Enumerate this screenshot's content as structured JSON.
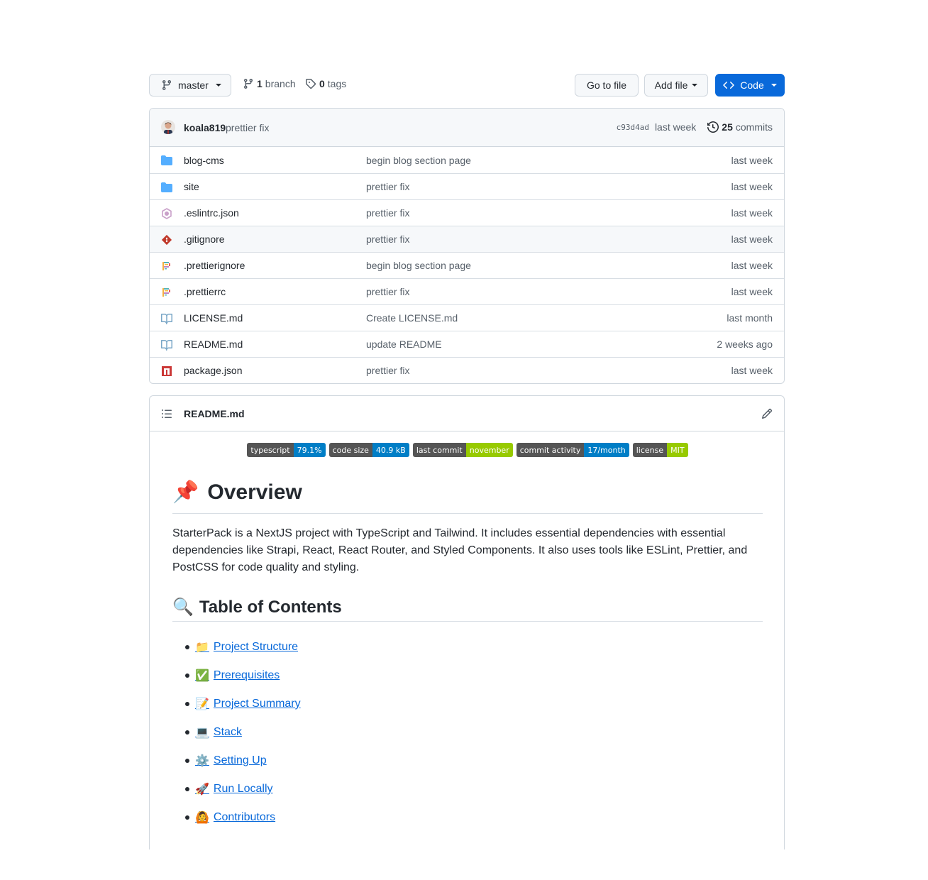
{
  "toolbar": {
    "branch_name": "master",
    "branches_count": "1",
    "branches_label": "branch",
    "tags_count": "0",
    "tags_label": "tags",
    "goto_label": "Go to file",
    "add_file_label": "Add file",
    "code_label": "Code"
  },
  "commit": {
    "author": "koala819",
    "message": "prettier fix",
    "sha": "c93d4ad",
    "time": "last week",
    "count": "25",
    "count_label": "commits"
  },
  "files": [
    {
      "name": "blog-cms",
      "message": "begin blog section page",
      "age": "last week",
      "icon": "folder-icon"
    },
    {
      "name": "site",
      "message": "prettier fix",
      "age": "last week",
      "icon": "folder-icon"
    },
    {
      "name": ".eslintrc.json",
      "message": "prettier fix",
      "age": "last week",
      "icon": "eslint-icon"
    },
    {
      "name": ".gitignore",
      "message": "prettier fix",
      "age": "last week",
      "icon": "git-icon"
    },
    {
      "name": ".prettierignore",
      "message": "begin blog section page",
      "age": "last week",
      "icon": "prettier-icon"
    },
    {
      "name": ".prettierrc",
      "message": "prettier fix",
      "age": "last week",
      "icon": "prettier-icon"
    },
    {
      "name": "LICENSE.md",
      "message": "Create LICENSE.md",
      "age": "last month",
      "icon": "book-icon"
    },
    {
      "name": "README.md",
      "message": "update README",
      "age": "2 weeks ago",
      "icon": "book-icon"
    },
    {
      "name": "package.json",
      "message": "prettier fix",
      "age": "last week",
      "icon": "npm-icon"
    }
  ],
  "readme": {
    "filename": "README.md",
    "badges": [
      {
        "label": "typescript",
        "value": "79.1%",
        "color": "#007ec6"
      },
      {
        "label": "code size",
        "value": "40.9 kB",
        "color": "#007ec6"
      },
      {
        "label": "last commit",
        "value": "november",
        "color": "#97ca00"
      },
      {
        "label": "commit activity",
        "value": "17/month",
        "color": "#007ec6"
      },
      {
        "label": "license",
        "value": "MIT",
        "color": "#97ca00"
      }
    ],
    "h1_emoji": "📌",
    "h1": "Overview",
    "paragraph": "StarterPack is a NextJS project with TypeScript and Tailwind. It includes essential dependencies with essential dependencies like Strapi, React, React Router, and Styled Components. It also uses tools like ESLint, Prettier, and PostCSS for code quality and styling.",
    "h2_emoji": "🔍",
    "h2": "Table of Contents",
    "toc": [
      {
        "emoji": "📁",
        "label": "Project Structure"
      },
      {
        "emoji": "✅",
        "label": "Prerequisites"
      },
      {
        "emoji": "📝",
        "label": "Project Summary"
      },
      {
        "emoji": "💻",
        "label": "Stack"
      },
      {
        "emoji": "⚙️",
        "label": "Setting Up"
      },
      {
        "emoji": "🚀",
        "label": "Run Locally"
      },
      {
        "emoji": "🙆",
        "label": "Contributors"
      }
    ]
  },
  "colors": {
    "accent": "#0969da",
    "border": "#d0d7de",
    "muted_text": "#57606a",
    "folder": "#54aeff"
  }
}
